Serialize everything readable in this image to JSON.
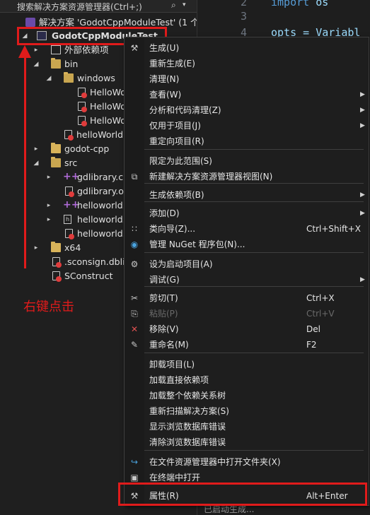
{
  "explorer": {
    "search_placeholder": "搜索解决方案资源管理器(Ctrl+;)",
    "search_icon": "search-icon",
    "solution_label": "解决方案 'GodotCppModuleTest' (1 个",
    "project_label": "GodotCppModuleTest",
    "nodes": [
      {
        "label": "外部依赖项",
        "icon": "external-deps-icon"
      },
      {
        "label": "bin",
        "icon": "folder-icon"
      },
      {
        "label": "windows",
        "icon": "folder-icon"
      },
      {
        "label": "HelloWo",
        "icon": "file-icon"
      },
      {
        "label": "HelloWo",
        "icon": "file-icon"
      },
      {
        "label": "HelloWo",
        "icon": "file-icon"
      },
      {
        "label": "helloWorld.",
        "icon": "file-icon"
      },
      {
        "label": "godot-cpp",
        "icon": "folder-icon"
      },
      {
        "label": "src",
        "icon": "folder-icon"
      },
      {
        "label": "gdlibrary.cp",
        "icon": "cpp-file-icon"
      },
      {
        "label": "gdlibrary.ob",
        "icon": "file-icon"
      },
      {
        "label": "helloworld.c",
        "icon": "cpp-file-icon"
      },
      {
        "label": "helloworld.h",
        "icon": "header-file-icon"
      },
      {
        "label": "helloworld.c",
        "icon": "file-icon"
      },
      {
        "label": "x64",
        "icon": "folder-icon"
      },
      {
        "label": ".sconsign.dblite",
        "icon": "file-icon"
      },
      {
        "label": "SConstruct",
        "icon": "file-icon"
      }
    ]
  },
  "editor": {
    "lines": [
      {
        "num": "2",
        "code_kw": "import",
        "code": " os"
      },
      {
        "num": "3",
        "code_kw": "",
        "code": ""
      },
      {
        "num": "4",
        "code_kw": "",
        "code": "opts = Variabl"
      }
    ],
    "bottom_partial": "已启动生成..."
  },
  "annotation": {
    "text": "右键点击",
    "color": "#e01b1b"
  },
  "context_menu": {
    "items": [
      {
        "label": "生成(U)",
        "icon": "build-icon",
        "shortcut": "",
        "submenu": false,
        "disabled": false
      },
      {
        "label": "重新生成(E)",
        "icon": "",
        "shortcut": "",
        "submenu": false,
        "disabled": false
      },
      {
        "label": "清理(N)",
        "icon": "",
        "shortcut": "",
        "submenu": false,
        "disabled": false
      },
      {
        "label": "查看(W)",
        "icon": "",
        "shortcut": "",
        "submenu": true,
        "disabled": false
      },
      {
        "label": "分析和代码清理(Z)",
        "icon": "",
        "shortcut": "",
        "submenu": true,
        "disabled": false
      },
      {
        "label": "仅用于项目(J)",
        "icon": "",
        "shortcut": "",
        "submenu": true,
        "disabled": false
      },
      {
        "label": "重定向项目(R)",
        "icon": "",
        "shortcut": "",
        "submenu": false,
        "disabled": false
      },
      {
        "label": "限定为此范围(S)",
        "icon": "",
        "shortcut": "",
        "submenu": false,
        "disabled": false
      },
      {
        "label": "新建解决方案资源管理器视图(N)",
        "icon": "new-view-icon",
        "shortcut": "",
        "submenu": false,
        "disabled": false
      },
      {
        "label": "生成依赖项(B)",
        "icon": "",
        "shortcut": "",
        "submenu": true,
        "disabled": false
      },
      {
        "label": "添加(D)",
        "icon": "",
        "shortcut": "",
        "submenu": true,
        "disabled": false
      },
      {
        "label": "类向导(Z)...",
        "icon": "class-wizard-icon",
        "shortcut": "Ctrl+Shift+X",
        "submenu": false,
        "disabled": false
      },
      {
        "label": "管理 NuGet 程序包(N)...",
        "icon": "nuget-icon",
        "shortcut": "",
        "submenu": false,
        "disabled": false
      },
      {
        "label": "设为启动项目(A)",
        "icon": "gear-icon",
        "shortcut": "",
        "submenu": false,
        "disabled": false
      },
      {
        "label": "调试(G)",
        "icon": "",
        "shortcut": "",
        "submenu": true,
        "disabled": false
      },
      {
        "label": "剪切(T)",
        "icon": "scissors-icon",
        "shortcut": "Ctrl+X",
        "submenu": false,
        "disabled": false
      },
      {
        "label": "粘贴(P)",
        "icon": "paste-icon",
        "shortcut": "Ctrl+V",
        "submenu": false,
        "disabled": true
      },
      {
        "label": "移除(V)",
        "icon": "remove-icon",
        "shortcut": "Del",
        "submenu": false,
        "disabled": false
      },
      {
        "label": "重命名(M)",
        "icon": "rename-icon",
        "shortcut": "F2",
        "submenu": false,
        "disabled": false
      },
      {
        "label": "卸载项目(L)",
        "icon": "",
        "shortcut": "",
        "submenu": false,
        "disabled": false
      },
      {
        "label": "加载直接依赖项",
        "icon": "",
        "shortcut": "",
        "submenu": false,
        "disabled": false
      },
      {
        "label": "加载整个依赖关系树",
        "icon": "",
        "shortcut": "",
        "submenu": false,
        "disabled": false
      },
      {
        "label": "重新扫描解决方案(S)",
        "icon": "",
        "shortcut": "",
        "submenu": false,
        "disabled": false
      },
      {
        "label": "显示浏览数据库错误",
        "icon": "",
        "shortcut": "",
        "submenu": false,
        "disabled": false
      },
      {
        "label": "清除浏览数据库错误",
        "icon": "",
        "shortcut": "",
        "submenu": false,
        "disabled": false
      },
      {
        "label": "在文件资源管理器中打开文件夹(X)",
        "icon": "open-folder-icon",
        "shortcut": "",
        "submenu": false,
        "disabled": false
      },
      {
        "label": "在终端中打开",
        "icon": "terminal-icon",
        "shortcut": "",
        "submenu": false,
        "disabled": false
      },
      {
        "label": "属性(R)",
        "icon": "wrench-icon",
        "shortcut": "Alt+Enter",
        "submenu": false,
        "disabled": false
      }
    ]
  }
}
